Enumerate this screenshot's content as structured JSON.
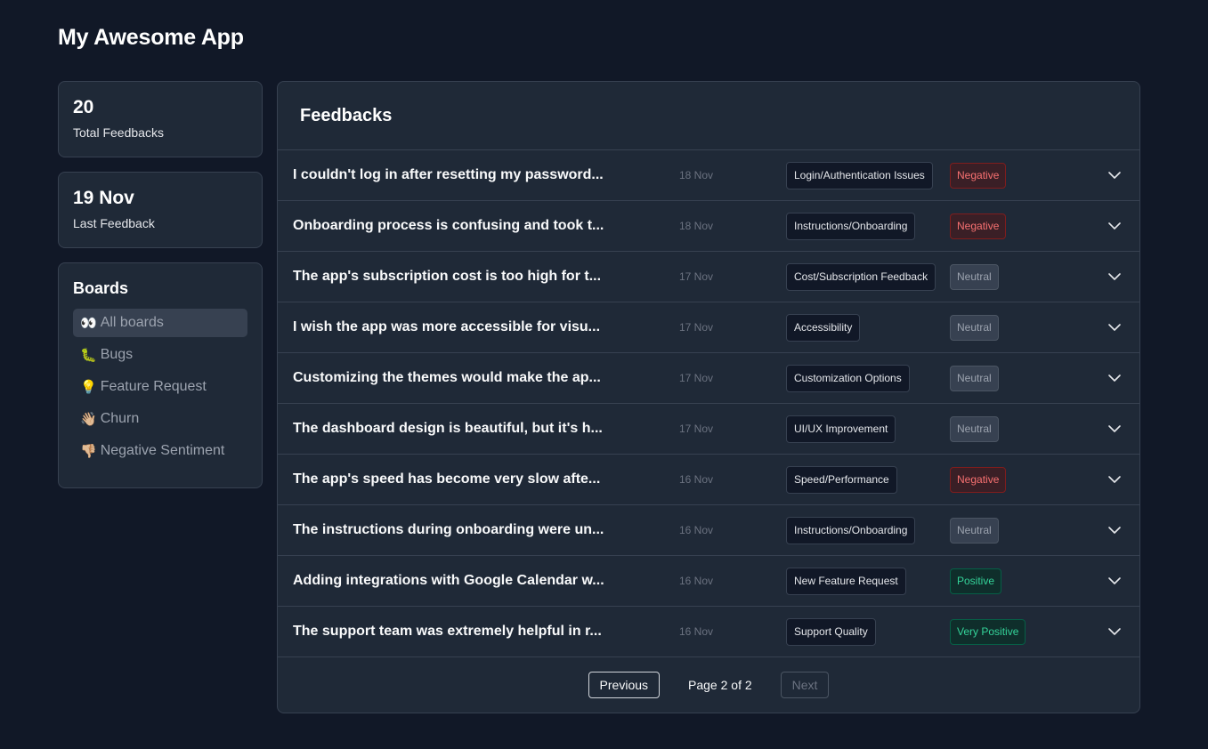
{
  "app": {
    "title": "My Awesome App"
  },
  "stats": [
    {
      "value": "20",
      "label": "Total Feedbacks"
    },
    {
      "value": "19 Nov",
      "label": "Last Feedback"
    }
  ],
  "boards": {
    "title": "Boards",
    "items": [
      {
        "emoji": "👀",
        "label": "All boards",
        "icon": "eyes-icon",
        "active": true
      },
      {
        "emoji": "🐛",
        "label": "Bugs",
        "icon": "bug-icon",
        "active": false
      },
      {
        "emoji": "💡",
        "label": "Feature Request",
        "icon": "lightbulb-icon",
        "active": false
      },
      {
        "emoji": "👋🏼",
        "label": "Churn",
        "icon": "waving-hand-icon",
        "active": false
      },
      {
        "emoji": "👎🏼",
        "label": "Negative Sentiment",
        "icon": "thumbs-down-icon",
        "active": false
      }
    ]
  },
  "feedbacks": {
    "title": "Feedbacks",
    "rows": [
      {
        "text": "I couldn't log in after resetting my password...",
        "date": "18 Nov",
        "category": "Login/Authentication Issues",
        "sentiment": "Negative"
      },
      {
        "text": "Onboarding process is confusing and took t...",
        "date": "18 Nov",
        "category": "Instructions/Onboarding",
        "sentiment": "Negative"
      },
      {
        "text": "The app's subscription cost is too high for t...",
        "date": "17 Nov",
        "category": "Cost/Subscription Feedback",
        "sentiment": "Neutral"
      },
      {
        "text": "I wish the app was more accessible for visu...",
        "date": "17 Nov",
        "category": "Accessibility",
        "sentiment": "Neutral"
      },
      {
        "text": "Customizing the themes would make the ap...",
        "date": "17 Nov",
        "category": "Customization Options",
        "sentiment": "Neutral"
      },
      {
        "text": "The dashboard design is beautiful, but it's h...",
        "date": "17 Nov",
        "category": "UI/UX Improvement",
        "sentiment": "Neutral"
      },
      {
        "text": "The app's speed has become very slow afte...",
        "date": "16 Nov",
        "category": "Speed/Performance",
        "sentiment": "Negative"
      },
      {
        "text": "The instructions during onboarding were un...",
        "date": "16 Nov",
        "category": "Instructions/Onboarding",
        "sentiment": "Neutral"
      },
      {
        "text": "Adding integrations with Google Calendar w...",
        "date": "16 Nov",
        "category": "New Feature Request",
        "sentiment": "Positive"
      },
      {
        "text": "The support team was extremely helpful in r...",
        "date": "16 Nov",
        "category": "Support Quality",
        "sentiment": "Very Positive"
      }
    ]
  },
  "pagination": {
    "previous_label": "Previous",
    "page_info": "Page 2 of 2",
    "next_label": "Next"
  },
  "colors": {
    "background": "#111827",
    "card": "#1f2937",
    "border": "#374151",
    "negative": "#f87171",
    "neutral": "#9ca3af",
    "positive": "#34d399"
  }
}
